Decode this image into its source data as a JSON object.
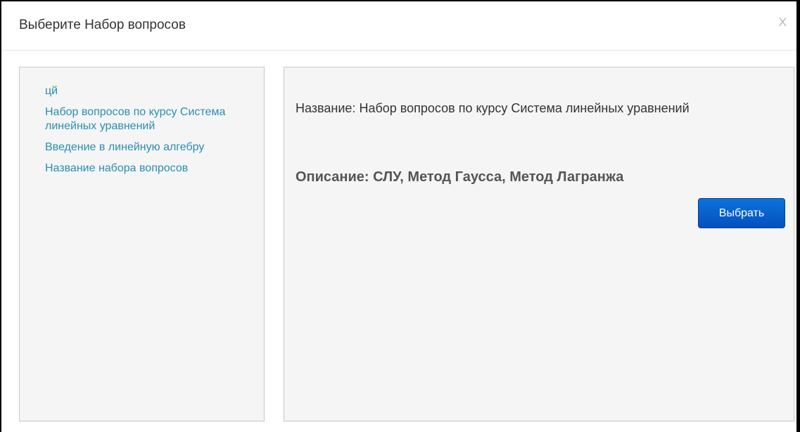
{
  "dialog": {
    "title": "Выберите Набор вопросов",
    "close_label": "X"
  },
  "question_sets": [
    {
      "label": "цй"
    },
    {
      "label": "Набор вопросов по курсу Система линейных уравнений"
    },
    {
      "label": "Введение в линейную алгебру"
    },
    {
      "label": "Название набора вопросов"
    }
  ],
  "detail": {
    "name_text": "Название: Набор вопросов по курсу Система линейных уравнений",
    "description_text": "Описание: СЛУ, Метод Гаусса, Метод Лагранжа",
    "select_button_label": "Выбрать"
  },
  "colors": {
    "link": "#2a8db1",
    "button": "#0a62d0",
    "panel_bg": "#f5f5f5"
  }
}
